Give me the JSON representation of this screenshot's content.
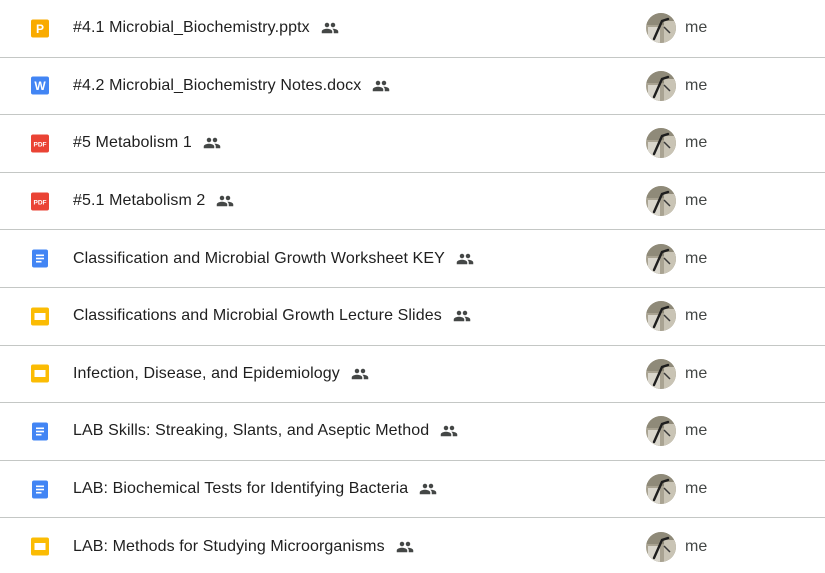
{
  "colors": {
    "pptx": "#f9ab00",
    "docx": "#4285f4",
    "pdf": "#ea4335",
    "docs": "#4285f4",
    "slides": "#fbbc04",
    "divider": "#c4c7c5"
  },
  "files": [
    {
      "name": "#4.1 Microbial_Biochemistry.pptx",
      "type": "pptx",
      "type_glyph": "P",
      "icon": "powerpoint-icon",
      "owner": "me"
    },
    {
      "name": "#4.2 Microbial_Biochemistry Notes.docx",
      "type": "docx",
      "type_glyph": "W",
      "icon": "word-icon",
      "owner": "me"
    },
    {
      "name": "#5 Metabolism 1",
      "type": "pdf",
      "type_glyph": "PDF",
      "icon": "pdf-icon",
      "owner": "me"
    },
    {
      "name": "#5.1 Metabolism 2",
      "type": "pdf",
      "type_glyph": "PDF",
      "icon": "pdf-icon",
      "owner": "me"
    },
    {
      "name": "Classification and Microbial Growth Worksheet KEY",
      "type": "docs",
      "icon": "google-docs-icon",
      "owner": "me"
    },
    {
      "name": "Classifications and Microbial Growth Lecture Slides",
      "type": "slides",
      "icon": "google-slides-icon",
      "owner": "me"
    },
    {
      "name": "Infection, Disease, and Epidemiology",
      "type": "slides",
      "icon": "google-slides-icon",
      "owner": "me"
    },
    {
      "name": "LAB Skills: Streaking, Slants, and Aseptic Method",
      "type": "docs",
      "icon": "google-docs-icon",
      "owner": "me"
    },
    {
      "name": "LAB: Biochemical Tests for Identifying Bacteria",
      "type": "docs",
      "icon": "google-docs-icon",
      "owner": "me"
    },
    {
      "name": "LAB: Methods for Studying Microorganisms",
      "type": "slides",
      "icon": "google-slides-icon",
      "owner": "me"
    }
  ],
  "shared_icon": "shared-people-icon",
  "avatar_icon": "avatar"
}
